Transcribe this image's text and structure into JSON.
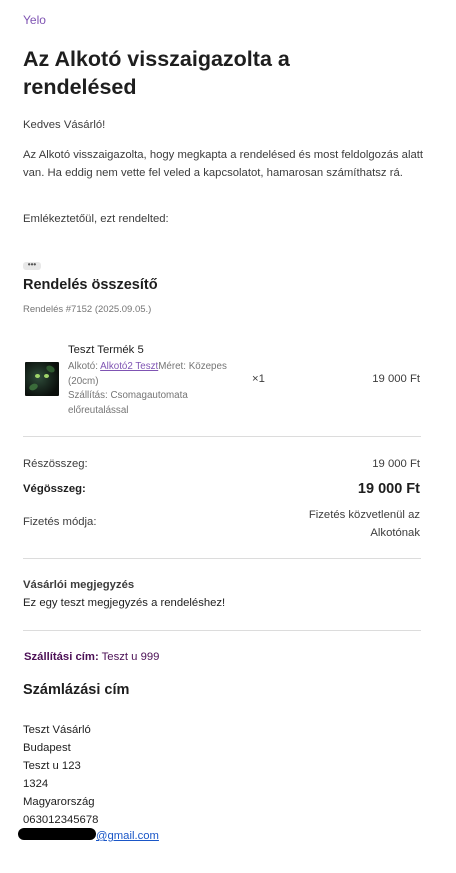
{
  "brand": "Yelo",
  "heading": "Az Alkotó visszaigazolta a rendelésed",
  "greeting": "Kedves Vásárló!",
  "intro": "Az Alkotó visszaigazolta, hogy megkapta a rendelésed és most feldolgozás alatt van. Ha eddig nem vette fel veled a kapcsolatot, hamarosan számíthatsz rá.",
  "reminder": "Emlékeztetőül, ezt rendelted:",
  "dots": "•••",
  "summary": {
    "title": "Rendelés összesítő",
    "order_number": "Rendelés #7152 (2025.09.05.)"
  },
  "item": {
    "name": "Teszt Termék 5",
    "creator_label": "Alkotó: ",
    "creator_link": "Alkotó2 Teszt",
    "size_text": "Méret: Közepes (20cm)",
    "shipping_text": "Szállítás: Csomagautomata előreutalással",
    "quantity": "×1",
    "price": "19 000 Ft"
  },
  "totals": {
    "subtotal_label": "Részösszeg:",
    "subtotal_value": "19 000 Ft",
    "total_label": "Végösszeg:",
    "total_value": "19 000 Ft",
    "payment_label": "Fizetés módja:",
    "payment_value": "Fizetés közvetlenül az Alkotónak"
  },
  "note": {
    "title": "Vásárlói megjegyzés",
    "text": "Ez egy teszt megjegyzés a rendeléshez!"
  },
  "shipping_address": {
    "label": "Szállítási cím:",
    "value": "Teszt u 999"
  },
  "billing": {
    "title": "Számlázási cím",
    "name": "Teszt Vásárló",
    "city": "Budapest",
    "street": "Teszt u 123",
    "zip": "1324",
    "country": "Magyarország",
    "phone": "063012345678",
    "email_visible": "@gmail.com"
  },
  "colors": {
    "brand_purple": "#7f54b3",
    "link_blue": "#1a56c7",
    "ship_purple": "#4b0f55"
  }
}
